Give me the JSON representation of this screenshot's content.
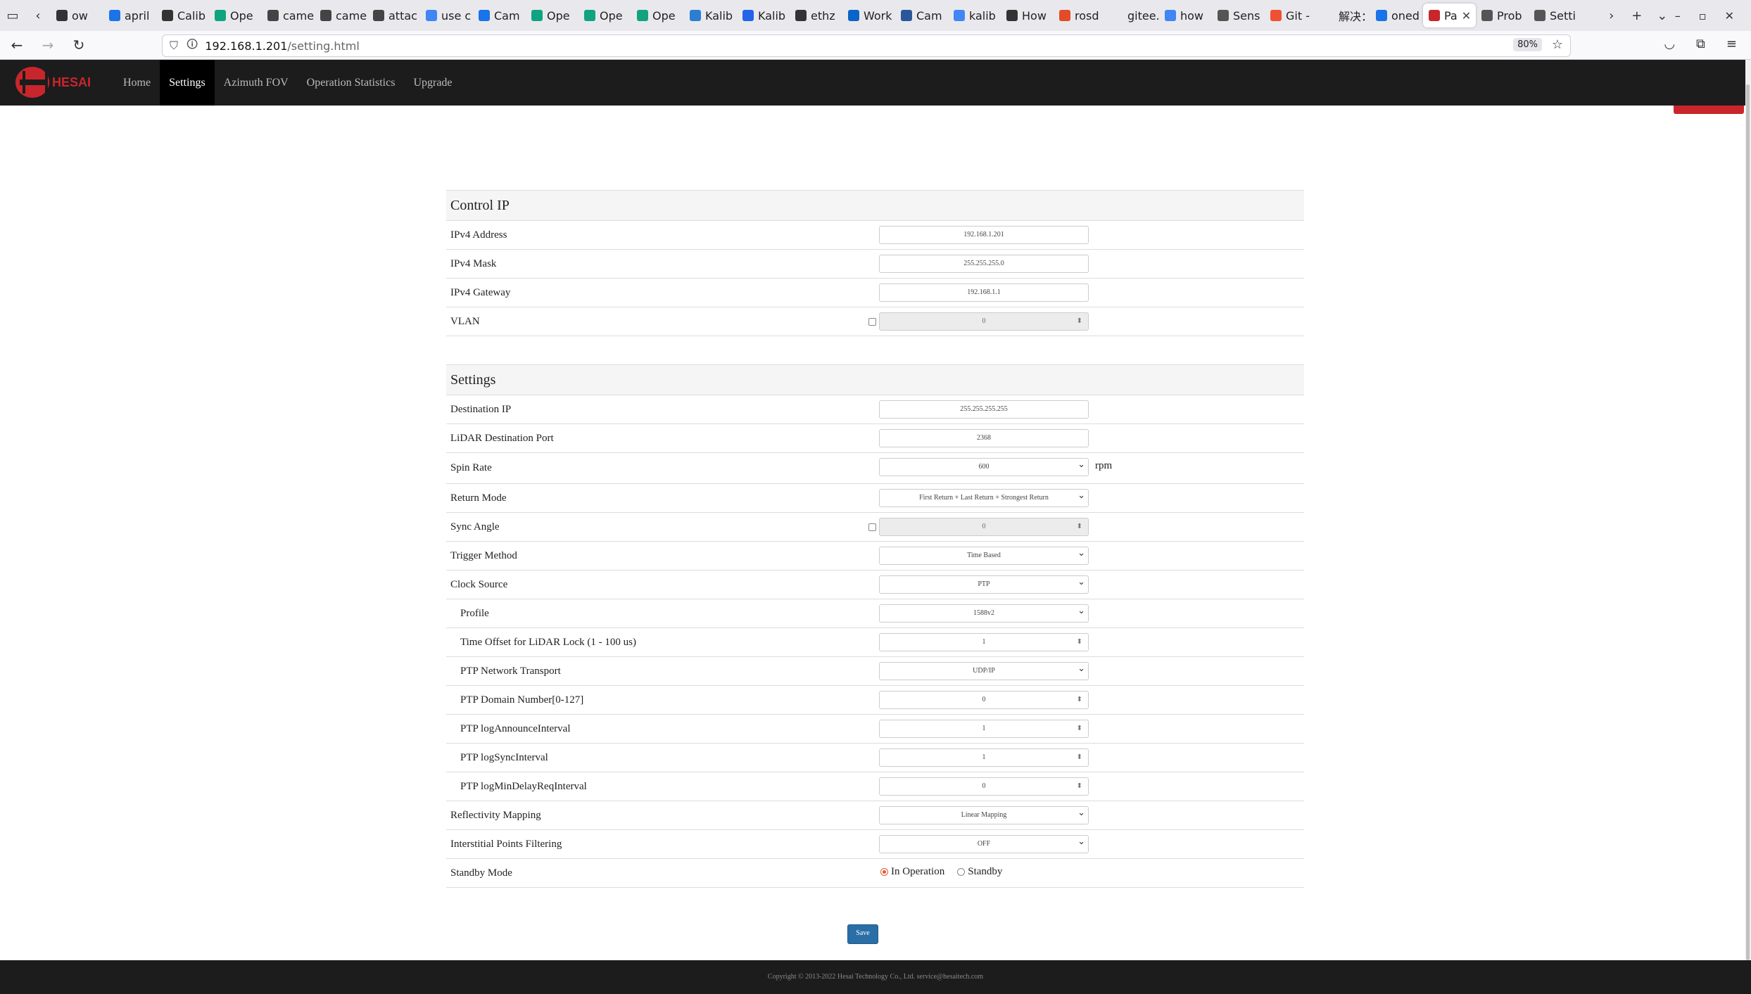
{
  "browser": {
    "tabs": [
      {
        "label": "ow",
        "icon": "github-icon"
      },
      {
        "label": "april",
        "icon": "drive-icon"
      },
      {
        "label": "Calib",
        "icon": "github-icon"
      },
      {
        "label": "Ope",
        "icon": "openai-icon"
      },
      {
        "label": "came",
        "icon": "grid-icon"
      },
      {
        "label": "came",
        "icon": "grid-icon"
      },
      {
        "label": "attac",
        "icon": "grid-icon"
      },
      {
        "label": "use c",
        "icon": "google-icon"
      },
      {
        "label": "Cam",
        "icon": "circle-icon"
      },
      {
        "label": "Ope",
        "icon": "openai-icon"
      },
      {
        "label": "Ope",
        "icon": "openai-icon"
      },
      {
        "label": "Ope",
        "icon": "openai-icon"
      },
      {
        "label": "Kalib",
        "icon": "cube-icon"
      },
      {
        "label": "Kalib",
        "icon": "z-icon"
      },
      {
        "label": "ethz",
        "icon": "github-icon"
      },
      {
        "label": "Work",
        "icon": "onedrive-icon"
      },
      {
        "label": "Cam",
        "icon": "word-icon"
      },
      {
        "label": "kalib",
        "icon": "google-icon"
      },
      {
        "label": "How",
        "icon": "github-icon"
      },
      {
        "label": "rosd",
        "icon": "c-icon"
      },
      {
        "label": "gitee.co",
        "icon": "none"
      },
      {
        "label": "how",
        "icon": "google-icon"
      },
      {
        "label": "Sens",
        "icon": "doc-icon"
      },
      {
        "label": "Git -",
        "icon": "git-icon"
      },
      {
        "label": "解决：/",
        "icon": "none"
      },
      {
        "label": "oned",
        "icon": "search-icon"
      },
      {
        "label": "Pa",
        "icon": "hesai-icon",
        "active": true
      },
      {
        "label": "Prob",
        "icon": "info-icon"
      },
      {
        "label": "Setti",
        "icon": "gear-icon"
      }
    ],
    "url_host": "192.168.1.201",
    "url_path": "/setting.html",
    "zoom": "80%"
  },
  "app": {
    "brand": "HESAI",
    "menu": [
      {
        "label": "Home"
      },
      {
        "label": "Settings",
        "active": true
      },
      {
        "label": "Azimuth FOV"
      },
      {
        "label": "Operation Statistics"
      },
      {
        "label": "Upgrade"
      }
    ]
  },
  "control_ip": {
    "title": "Control IP",
    "ipv4_address": {
      "label": "IPv4 Address",
      "value": "192.168.1.201"
    },
    "ipv4_mask": {
      "label": "IPv4 Mask",
      "value": "255.255.255.0"
    },
    "ipv4_gateway": {
      "label": "IPv4 Gateway",
      "value": "192.168.1.1"
    },
    "vlan": {
      "label": "VLAN",
      "value": "0",
      "checked": false
    }
  },
  "settings": {
    "title": "Settings",
    "destination_ip": {
      "label": "Destination IP",
      "value": "255.255.255.255"
    },
    "lidar_port": {
      "label": "LiDAR Destination Port",
      "value": "2368"
    },
    "spin_rate": {
      "label": "Spin Rate",
      "value": "600",
      "unit": "rpm"
    },
    "return_mode": {
      "label": "Return Mode",
      "value": "First Return + Last Return + Strongest Return"
    },
    "sync_angle": {
      "label": "Sync Angle",
      "value": "0",
      "checked": false
    },
    "trigger_method": {
      "label": "Trigger Method",
      "value": "Time Based"
    },
    "clock_source": {
      "label": "Clock Source",
      "value": "PTP"
    },
    "profile": {
      "label": "Profile",
      "value": "1588v2"
    },
    "time_offset": {
      "label": "Time Offset for LiDAR Lock (1 - 100 us)",
      "value": "1"
    },
    "ptp_transport": {
      "label": "PTP Network Transport",
      "value": "UDP/IP"
    },
    "ptp_domain": {
      "label": "PTP Domain Number[0-127]",
      "value": "0"
    },
    "ptp_announce": {
      "label": "PTP logAnnounceInterval",
      "value": "1"
    },
    "ptp_sync": {
      "label": "PTP logSyncInterval",
      "value": "1"
    },
    "ptp_mindelay": {
      "label": "PTP logMinDelayReqInterval",
      "value": "0"
    },
    "reflectivity": {
      "label": "Reflectivity Mapping",
      "value": "Linear Mapping"
    },
    "interstitial": {
      "label": "Interstitial Points Filtering",
      "value": "OFF"
    },
    "standby": {
      "label": "Standby Mode",
      "option_on": "In Operation",
      "option_off": "Standby",
      "selected": "In Operation"
    }
  },
  "save_label": "Save",
  "footer": "Copyright © 2013-2022 Hesai Technology Co., Ltd. service@hesaitech.com"
}
